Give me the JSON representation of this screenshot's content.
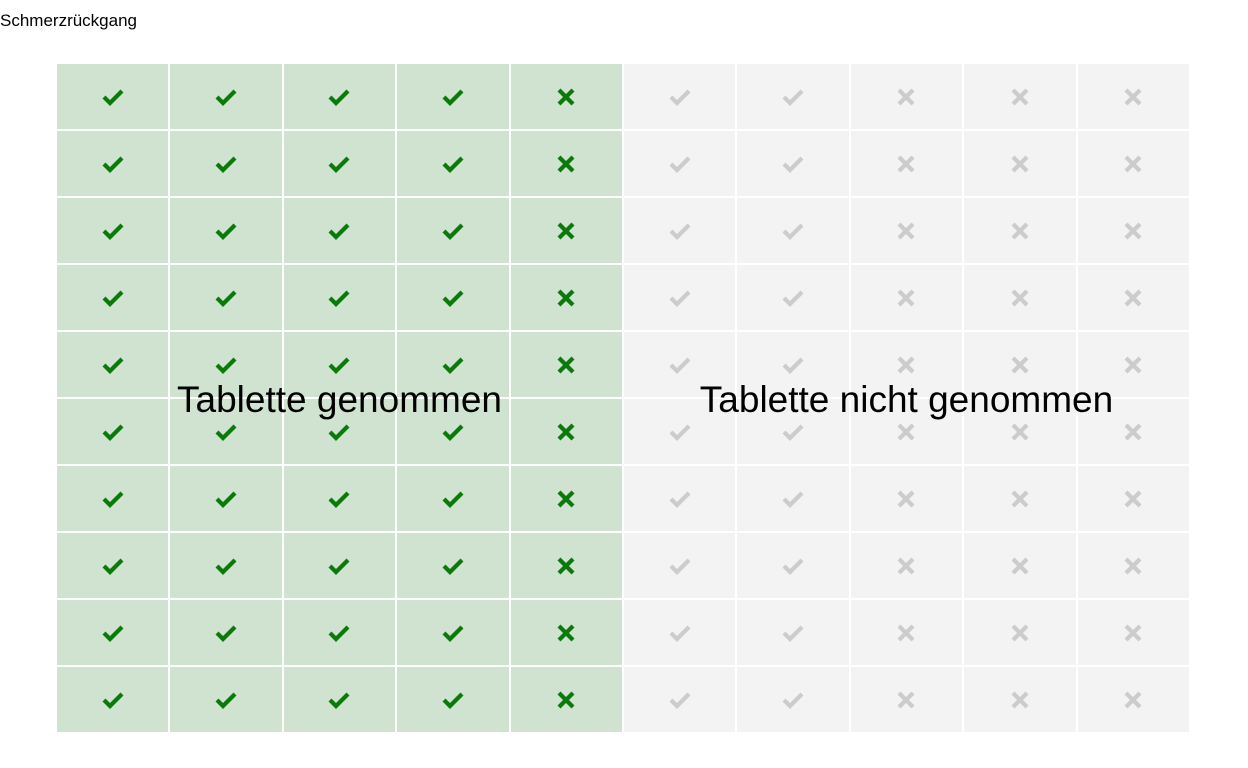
{
  "title": "Schmerzrückgang",
  "groups": [
    {
      "label": "Tablette genommen",
      "background": "#d0e3d0",
      "icon_color": "#0b7a0b",
      "columns": [
        "check-icon",
        "check-icon",
        "check-icon",
        "check-icon",
        "cross-icon"
      ]
    },
    {
      "label": "Tablette nicht genommen",
      "background": "#f3f3f3",
      "icon_color": "#cccccc",
      "columns": [
        "check-icon",
        "check-icon",
        "cross-icon",
        "cross-icon",
        "cross-icon"
      ]
    }
  ],
  "rows_per_column": 10
}
